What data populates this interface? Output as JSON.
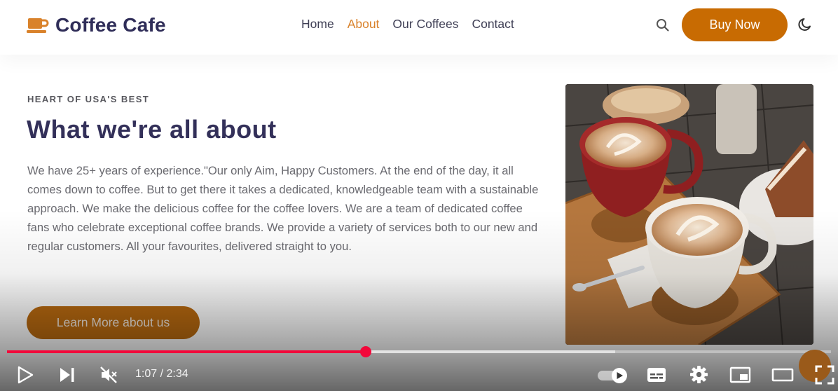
{
  "site": {
    "brand": "Coffee Cafe",
    "nav": [
      {
        "label": "Home",
        "active": false
      },
      {
        "label": "About",
        "active": true
      },
      {
        "label": "Our Coffees",
        "active": false
      },
      {
        "label": "Contact",
        "active": false
      }
    ],
    "search_icon": "search-icon",
    "buy_label": "Buy Now",
    "theme_icon": "moon-icon"
  },
  "about": {
    "eyebrow": "HEART OF USA'S BEST",
    "title": "What we're all about",
    "body": "We have 25+ years of experience.\"Our only Aim, Happy Customers. At the end of the day, it all comes down to coffee. But to get there it takes a dedicated, knowledgeable team with a sustainable approach. We make the delicious coffee for the coffee lovers. We are a team of dedicated coffee fans who celebrate exceptional coffee brands. We provide a variety of services both to our new and regular customers. All your favourites, delivered straight to you.",
    "cta_label": "Learn More about us",
    "image": "latte-cups-photo"
  },
  "player": {
    "time": "1:07 / 2:34",
    "progress_fraction": 0.435,
    "buffered_fraction": 0.738,
    "muted": true,
    "autoplay_on": true,
    "icons": [
      "play-icon",
      "next-icon",
      "mute-icon",
      "autoplay-toggle",
      "subtitles-icon",
      "settings-icon",
      "miniplayer-icon",
      "theater-icon",
      "fullscreen-icon"
    ]
  },
  "colors": {
    "brand_text": "#2f2d58",
    "accent": "#c86b02",
    "nav_active": "#d9822b",
    "progress": "#f2083a"
  }
}
